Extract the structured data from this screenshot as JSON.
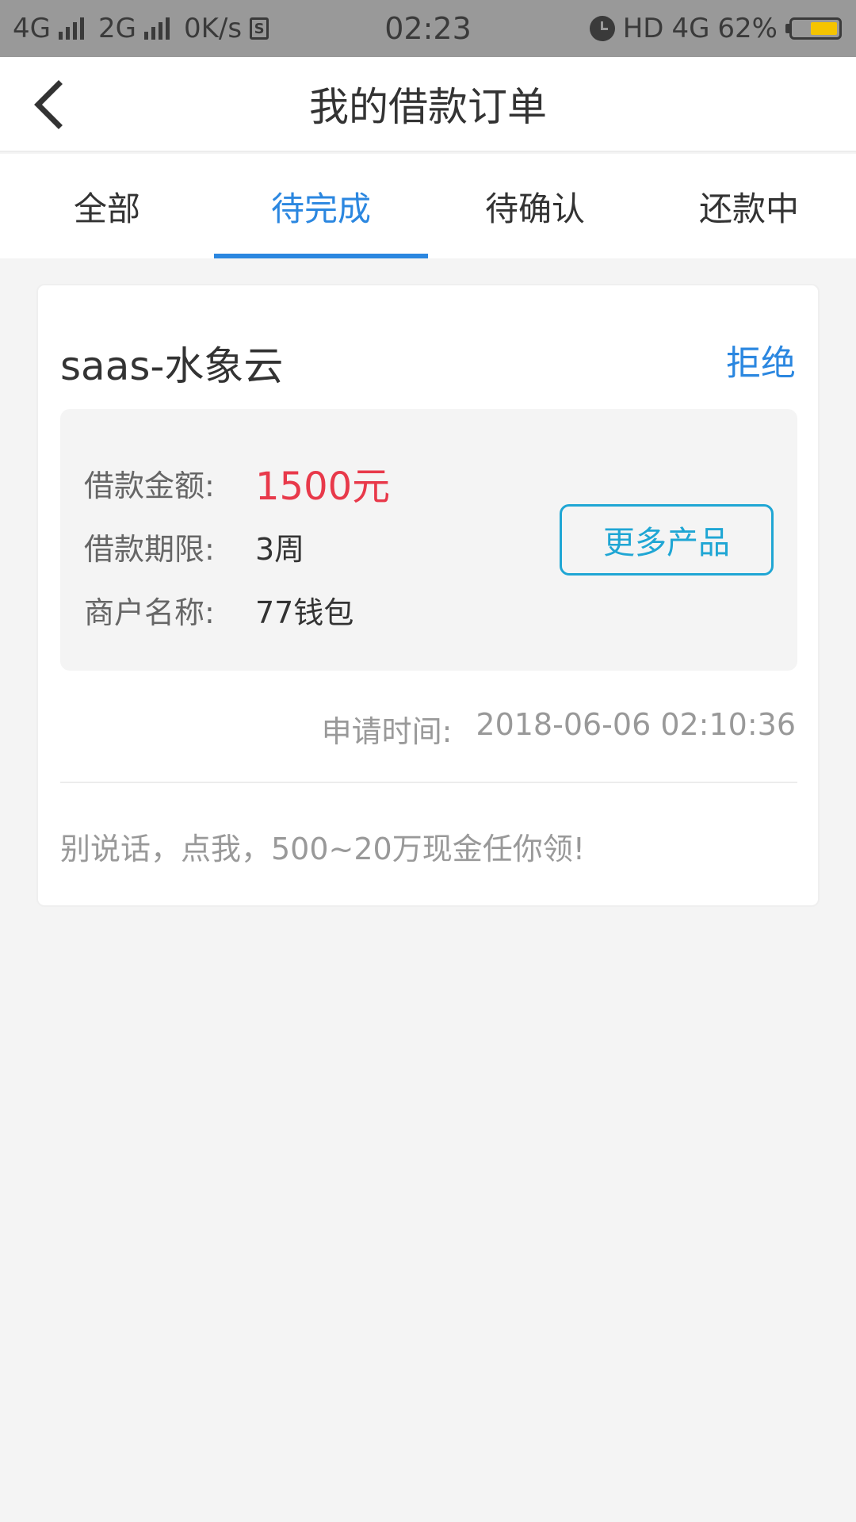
{
  "status_bar": {
    "network1": "4G",
    "network2": "2G",
    "speed": "0K/s",
    "sim_icon_text": "S",
    "time": "02:23",
    "hd": "HD",
    "network3": "4G",
    "battery": "62%",
    "battery_level": 0.62,
    "icons": [
      "signal-icon",
      "sim-icon",
      "alarm-icon",
      "battery-icon"
    ]
  },
  "header": {
    "title": "我的借款订单",
    "back_icon": "chevron-left-icon"
  },
  "tabs": [
    {
      "label": "全部",
      "active": false
    },
    {
      "label": "待完成",
      "active": true
    },
    {
      "label": "待确认",
      "active": false
    },
    {
      "label": "还款中",
      "active": false
    }
  ],
  "order": {
    "product_name": "saas-水象云",
    "reject_label": "拒绝",
    "details": [
      {
        "label": "借款金额:",
        "value": "1500元"
      },
      {
        "label": "借款期限:",
        "value": "3周"
      },
      {
        "label": "商户名称:",
        "value": "77钱包"
      }
    ],
    "more_button": "更多产品",
    "apply_time_label": "申请时间:",
    "apply_time_value": "2018-06-06 02:10:36",
    "promo_text": "别说话，点我，500~20万现金任你领!"
  },
  "colors": {
    "accent": "#2b87e0",
    "amount": "#e8394a",
    "button_border": "#1fa6d4",
    "battery_fill": "#f5c400"
  }
}
